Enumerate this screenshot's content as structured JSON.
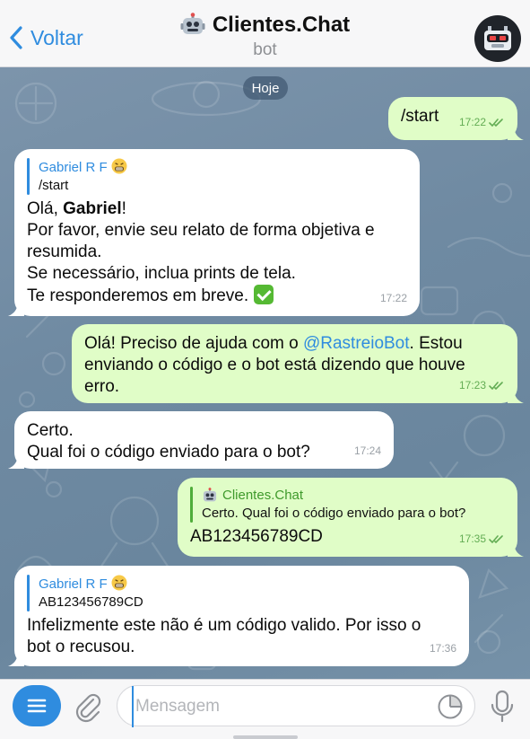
{
  "header": {
    "back_label": "Voltar",
    "title": "Clientes.Chat",
    "subtitle": "bot"
  },
  "chat": {
    "date_separator": "Hoje",
    "messages": [
      {
        "direction": "out",
        "lines": [
          "/start"
        ],
        "time": "17:22",
        "status": "read"
      },
      {
        "direction": "in",
        "reply_name": "Gabriel R F",
        "reply_text": "/start",
        "greeting": "Olá, ",
        "greeting_name": "Gabriel",
        "greeting_end": "!",
        "lines": [
          "Por favor, envie seu relato de forma objetiva e",
          "resumida.",
          "Se necessário, inclua prints de tela.",
          "Te responderemos em breve."
        ],
        "time": "17:22"
      },
      {
        "direction": "out",
        "line1_pre": "Olá! Preciso de ajuda com o ",
        "mention": "@RastreioBot",
        "line1_post": ". Estou",
        "lines": [
          "enviando o código e o bot está dizendo que houve",
          "erro."
        ],
        "time": "17:23",
        "status": "read"
      },
      {
        "direction": "in",
        "lines": [
          "Certo.",
          "Qual foi o código enviado para o bot?"
        ],
        "time": "17:24"
      },
      {
        "direction": "out",
        "reply_name": "Clientes.Chat",
        "reply_text": "Certo. Qual foi o código enviado para o bot?",
        "lines": [
          "AB123456789CD"
        ],
        "time": "17:35",
        "status": "read"
      },
      {
        "direction": "in",
        "reply_name": "Gabriel R F",
        "reply_text": "AB123456789CD",
        "lines": [
          "Infelizmente este não é um código valido. Por isso o",
          "bot o recusou."
        ],
        "time": "17:36"
      }
    ]
  },
  "composer": {
    "placeholder": "Mensagem"
  },
  "icons": {
    "back": "chevron-left-icon",
    "bot": "robot-icon",
    "menu": "menu-icon",
    "attach": "paperclip-icon",
    "sticker": "sticker-icon",
    "mic": "microphone-icon",
    "read": "double-check-icon"
  },
  "colors": {
    "accent": "#2f8cdf",
    "outgoing_bubble": "#e0fdc7",
    "incoming_bubble": "#ffffff",
    "wallpaper": "#7591a8"
  }
}
